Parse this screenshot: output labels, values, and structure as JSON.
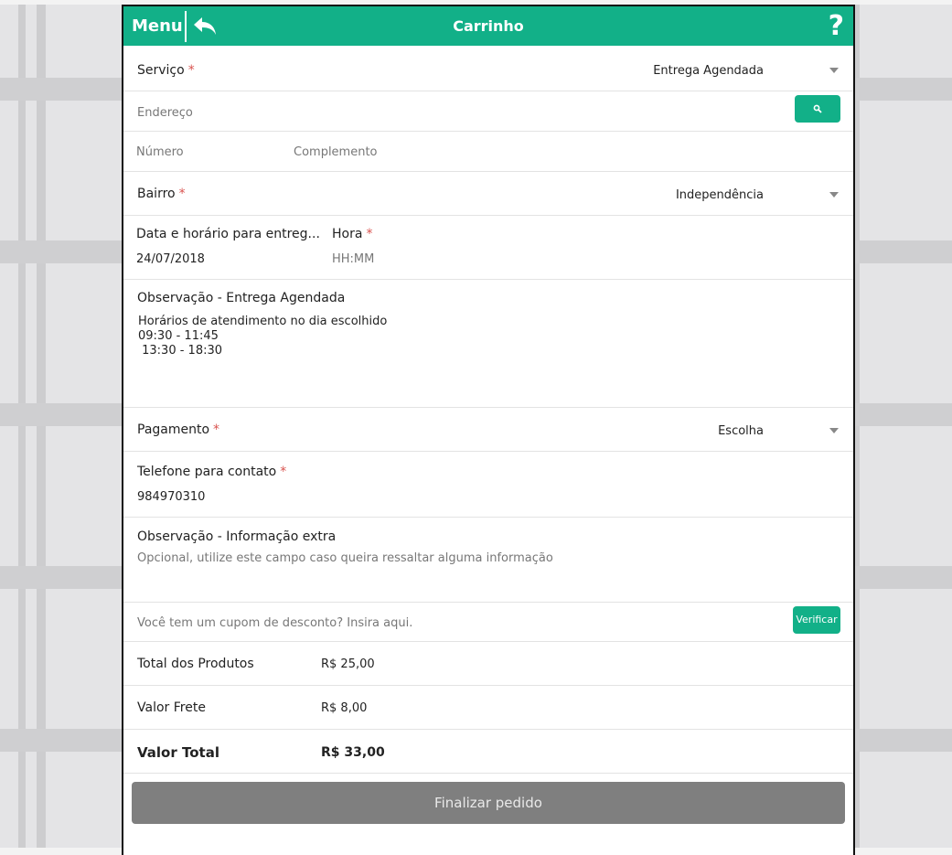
{
  "header": {
    "menu_label": "Menu",
    "title": "Carrinho",
    "help_symbol": "?"
  },
  "form": {
    "servico": {
      "label": "Serviço",
      "required_mark": "*",
      "value": "Entrega Agendada"
    },
    "endereco": {
      "placeholder": "Endereço"
    },
    "numero": {
      "placeholder": "Número"
    },
    "complemento": {
      "placeholder": "Complemento"
    },
    "bairro": {
      "label": "Bairro",
      "required_mark": "*",
      "value": "Independência"
    },
    "data": {
      "label": "Data e horário para entreg...",
      "value": "24/07/2018"
    },
    "hora": {
      "label": "Hora",
      "required_mark": "*",
      "placeholder": "HH:MM"
    },
    "observacao_entrega": {
      "label": "Observação - Entrega Agendada",
      "text": "Horários de atendimento no dia escolhido\n09:30 - 11:45\n 13:30 - 18:30"
    },
    "pagamento": {
      "label": "Pagamento",
      "required_mark": "*",
      "value": "Escolha"
    },
    "telefone": {
      "label": "Telefone para contato",
      "required_mark": "*",
      "value": "984970310"
    },
    "observacao_extra": {
      "label": "Observação - Informação extra",
      "placeholder": "Opcional, utilize este campo caso queira ressaltar alguma informação"
    },
    "cupom": {
      "placeholder": "Você tem um cupom de desconto? Insira aqui.",
      "button_label": "Verificar"
    }
  },
  "totals": {
    "produtos": {
      "label": "Total dos Produtos",
      "value": "R$ 25,00"
    },
    "frete": {
      "label": "Valor Frete",
      "value": "R$ 8,00"
    },
    "total": {
      "label": "Valor Total",
      "value": "R$ 33,00"
    }
  },
  "finalize_label": "Finalizar pedido",
  "icons": {
    "back": "reply-arrow-icon",
    "search": "search-icon",
    "help": "question-mark-icon",
    "dropdown": "chevron-down-icon"
  },
  "colors": {
    "accent": "#12b088",
    "finalize_button": "#7f7f7f",
    "required": "#d9534f"
  }
}
